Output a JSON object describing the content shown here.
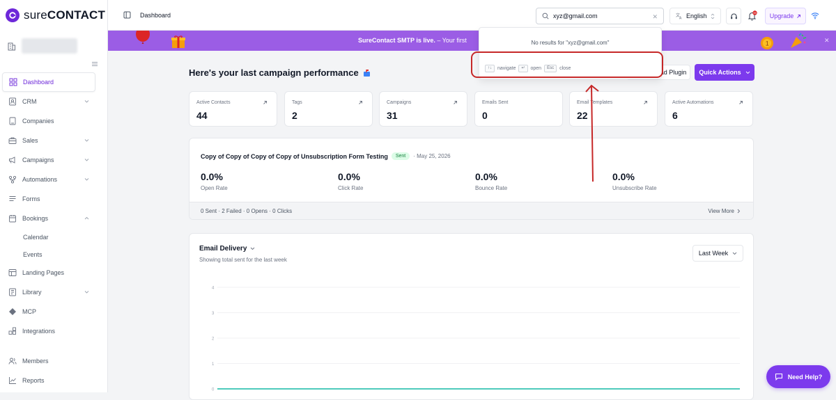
{
  "brand": {
    "logo_text_light": "sure",
    "logo_text_bold": "CONTACT",
    "accent": "#7c3aed"
  },
  "sidebar": {
    "items": [
      {
        "label": "Dashboard",
        "icon": "dashboard-icon",
        "active": true
      },
      {
        "label": "CRM",
        "icon": "crm-icon",
        "chevron": "down"
      },
      {
        "label": "Companies",
        "icon": "building-icon"
      },
      {
        "label": "Sales",
        "icon": "briefcase-icon",
        "chevron": "down"
      },
      {
        "label": "Campaigns",
        "icon": "megaphone-icon",
        "chevron": "down"
      },
      {
        "label": "Automations",
        "icon": "automation-icon",
        "chevron": "down"
      },
      {
        "label": "Forms",
        "icon": "forms-icon"
      },
      {
        "label": "Bookings",
        "icon": "calendar-icon",
        "chevron": "up"
      },
      {
        "label": "Calendar",
        "sub": true
      },
      {
        "label": "Events",
        "sub": true
      },
      {
        "label": "Landing Pages",
        "icon": "landing-page-icon"
      },
      {
        "label": "Library",
        "icon": "library-icon",
        "chevron": "down"
      },
      {
        "label": "MCP",
        "icon": "mcp-icon"
      },
      {
        "label": "Integrations",
        "icon": "integrations-icon"
      },
      {
        "label": "Members",
        "icon": "members-icon"
      },
      {
        "label": "Reports",
        "icon": "reports-icon"
      }
    ]
  },
  "header": {
    "breadcrumb": "Dashboard",
    "search_value": "xyz@gmail.com",
    "language": "English",
    "upgrade_label": "Upgrade"
  },
  "banner": {
    "bold": "SureContact SMTP is live.",
    "rest": " – Your first"
  },
  "search_dropdown": {
    "no_results": "No results for \"xyz@gmail.com\"",
    "hints": [
      {
        "key": "↑↓",
        "label": "navigate"
      },
      {
        "key": "↵",
        "label": "open"
      },
      {
        "key": "Esc",
        "label": "close"
      }
    ]
  },
  "main": {
    "title": "Here's your last campaign performance",
    "download_label": "Download Plugin",
    "quick_actions_label": "Quick Actions",
    "stats": [
      {
        "label": "Active Contacts",
        "value": "44"
      },
      {
        "label": "Tags",
        "value": "2"
      },
      {
        "label": "Campaigns",
        "value": "31"
      },
      {
        "label": "Emails Sent",
        "value": "0"
      },
      {
        "label": "Email Templates",
        "value": "22"
      },
      {
        "label": "Active Automations",
        "value": "6"
      }
    ],
    "campaign": {
      "name": "Copy of Copy of Copy of Copy of Unsubscription Form Testing",
      "status": "Sent",
      "date": "· May 25, 2026",
      "metrics": [
        {
          "value": "0.0%",
          "label": "Open Rate"
        },
        {
          "value": "0.0%",
          "label": "Click Rate"
        },
        {
          "value": "0.0%",
          "label": "Bounce Rate"
        },
        {
          "value": "0.0%",
          "label": "Unsubscribe Rate"
        }
      ],
      "footer": "0 Sent · 2 Failed · 0 Opens · 0 Clicks",
      "view_more": "View More"
    },
    "delivery": {
      "title": "Email Delivery",
      "subtitle": "Showing total sent for the last week",
      "range": "Last Week"
    }
  },
  "chart_data": {
    "type": "line",
    "title": "Email Delivery",
    "y_ticks": [
      "4",
      "3",
      "2",
      "1",
      "0"
    ],
    "ylim": [
      0,
      4
    ],
    "series": [
      {
        "values": [
          0,
          0,
          0,
          0,
          0,
          0,
          0
        ],
        "color": "#14b8a6"
      }
    ],
    "grid": true
  },
  "need_help_label": "Need Help?"
}
